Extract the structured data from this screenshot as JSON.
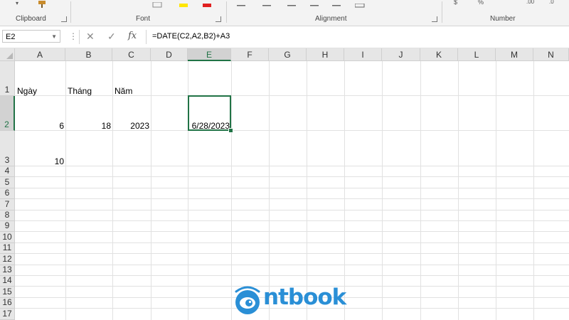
{
  "ribbon": {
    "groups": [
      {
        "label": "Clipboard"
      },
      {
        "label": "Font"
      },
      {
        "label": "Alignment"
      },
      {
        "label": "Number"
      }
    ],
    "merge_label": "Merge & Center"
  },
  "formula_bar": {
    "name_box": "E2",
    "formula": "=DATE(C2,A2,B2)+A3",
    "fx_label": "fx"
  },
  "grid": {
    "columns": [
      "A",
      "B",
      "C",
      "D",
      "E",
      "F",
      "G",
      "H",
      "I",
      "J",
      "K",
      "L",
      "M",
      "N"
    ],
    "rows": [
      "1",
      "2",
      "3",
      "4",
      "5",
      "6",
      "7",
      "8",
      "9",
      "10",
      "11",
      "12",
      "13",
      "14",
      "15",
      "16",
      "17"
    ],
    "selected_cell": "E2",
    "cells": {
      "A1": "Ngày",
      "B1": "Tháng",
      "C1": "Năm",
      "A2": "6",
      "B2": "18",
      "C2": "2023",
      "E2": "6/28/2023",
      "A3": "10"
    },
    "accent_color": "#217346"
  },
  "watermark": {
    "brand": "ntbook",
    "icon": "eye-logo-icon",
    "color": "#2a8fd6"
  }
}
